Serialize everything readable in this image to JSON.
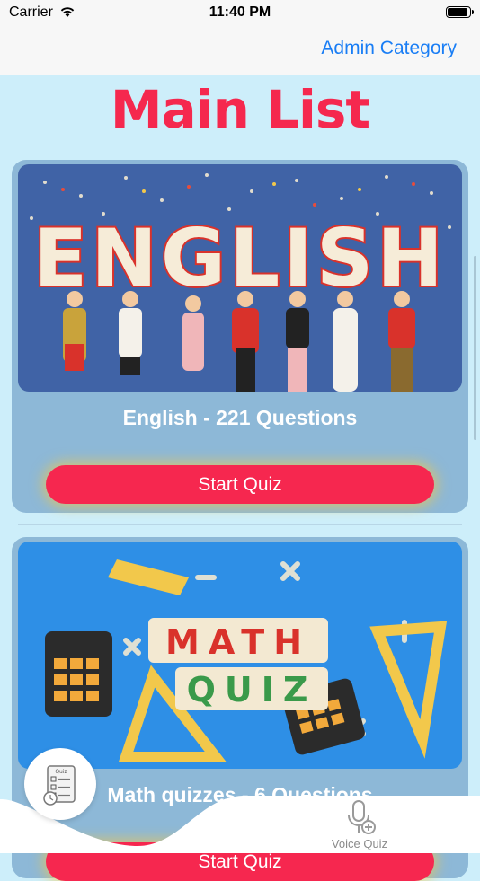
{
  "status_bar": {
    "carrier": "Carrier",
    "time": "11:40 PM"
  },
  "nav": {
    "admin_label": "Admin Category"
  },
  "page": {
    "title": "Main List"
  },
  "cards": [
    {
      "banner_text": "ENGLISH",
      "title": "English - 221 Questions",
      "button": "Start Quiz"
    },
    {
      "banner_text_1": "MATH",
      "banner_text_2": "QUIZ",
      "title": "Math quizzes - 6 Questions",
      "button": "Start Quiz"
    }
  ],
  "tab_bar": {
    "voice_label": "Voice Quiz",
    "quiz_icon_label": "Quiz"
  },
  "colors": {
    "accent": "#f5284e",
    "link": "#1a7ef5",
    "card": "#8db8d7",
    "background": "#cdeefa"
  }
}
